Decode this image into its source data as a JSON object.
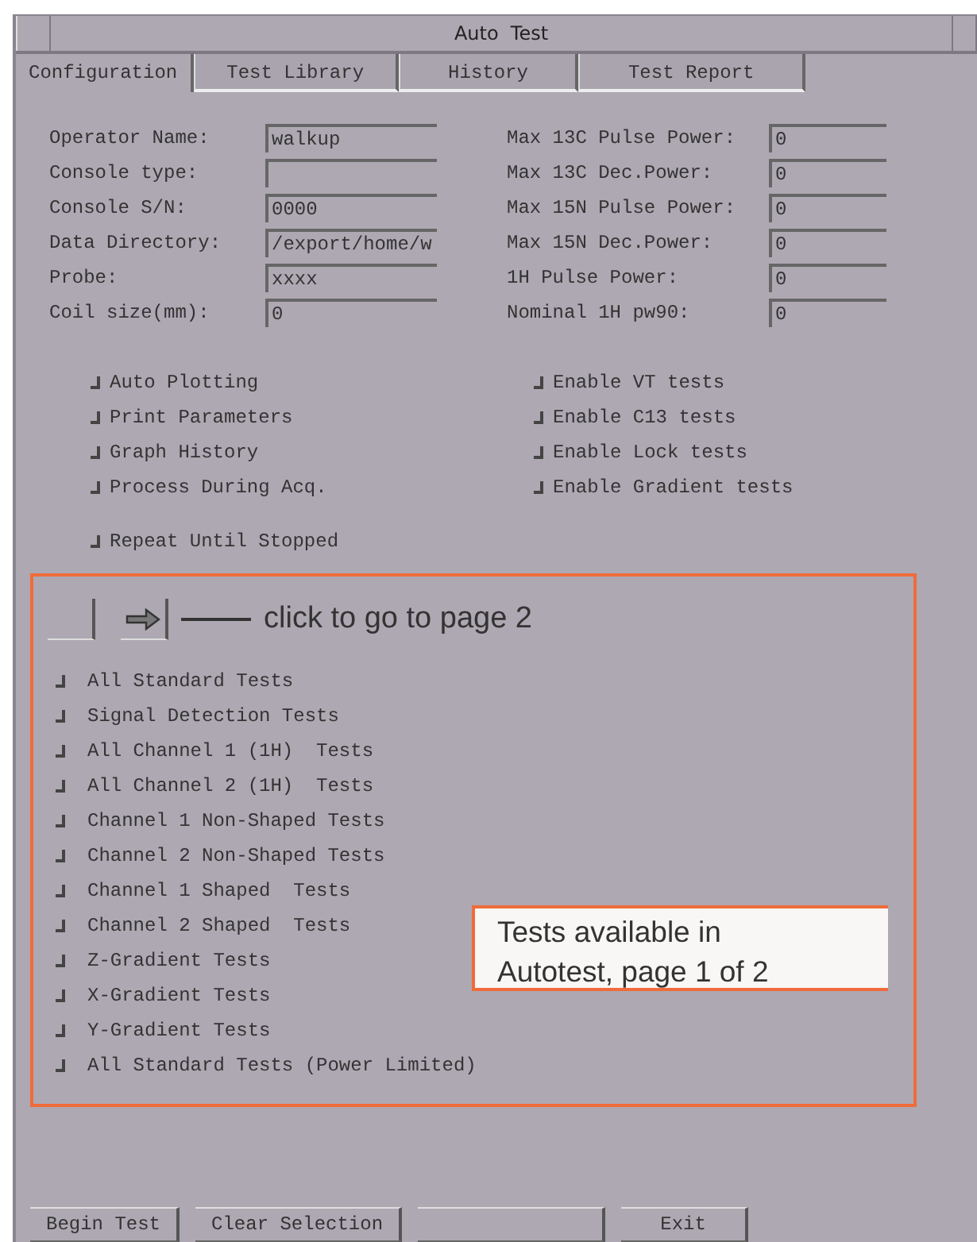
{
  "window": {
    "title": "Auto  Test"
  },
  "tabs": [
    {
      "label": "Configuration",
      "selected": true
    },
    {
      "label": "Test Library",
      "selected": false
    },
    {
      "label": "History",
      "selected": false
    },
    {
      "label": "Test Report",
      "selected": false
    }
  ],
  "fields_left": [
    {
      "label": "Operator Name:",
      "value": "walkup"
    },
    {
      "label": "Console type:"
    },
    {
      "label": "Console S/N:",
      "value": "0000"
    },
    {
      "label": "Data Directory:",
      "value": "/export/home/w"
    },
    {
      "label": "Probe:",
      "value": "xxxx"
    },
    {
      "label": "Coil size(mm):",
      "value": "0"
    }
  ],
  "fields_right": [
    {
      "label": "Max 13C Pulse Power:",
      "value": "0"
    },
    {
      "label": "Max 13C Dec.Power:",
      "value": "0"
    },
    {
      "label": "Max 15N Pulse Power:",
      "value": "0"
    },
    {
      "label": "Max 15N Dec.Power:",
      "value": "0"
    },
    {
      "label": "1H Pulse Power:",
      "value": "0"
    },
    {
      "label": "Nominal 1H pw90:",
      "value": "0"
    }
  ],
  "options_left": [
    {
      "label": "Auto Plotting",
      "checked": false
    },
    {
      "label": "Print Parameters",
      "checked": false
    },
    {
      "label": "Graph History",
      "checked": false
    },
    {
      "label": "Process During Acq.",
      "checked": false
    }
  ],
  "options_right": [
    {
      "label": "Enable VT tests",
      "checked": false
    },
    {
      "label": "Enable C13 tests",
      "checked": false
    },
    {
      "label": "Enable Lock tests",
      "checked": false
    },
    {
      "label": "Enable Gradient tests",
      "checked": false
    }
  ],
  "repeat_option": {
    "label": "Repeat Until Stopped",
    "checked": false
  },
  "page_note": "click to go to page 2",
  "tests": [
    {
      "label": "All Standard Tests",
      "checked": false
    },
    {
      "label": "Signal Detection Tests",
      "checked": false
    },
    {
      "label": "All Channel 1 (1H)  Tests",
      "checked": false
    },
    {
      "label": "All Channel 2 (1H)  Tests",
      "checked": false
    },
    {
      "label": "Channel 1 Non-Shaped Tests",
      "checked": false
    },
    {
      "label": "Channel 2 Non-Shaped Tests",
      "checked": false
    },
    {
      "label": "Channel 1 Shaped  Tests",
      "checked": false
    },
    {
      "label": "Channel 2 Shaped  Tests",
      "checked": false
    },
    {
      "label": "Z-Gradient Tests",
      "checked": false
    },
    {
      "label": "X-Gradient Tests",
      "checked": false
    },
    {
      "label": "Y-Gradient Tests",
      "checked": false
    },
    {
      "label": "All Standard Tests (Power Limited)",
      "checked": false
    }
  ],
  "callout": "Tests available in Autotest, page 1 of 2",
  "buttons": [
    {
      "kind": "labeled",
      "label": "Begin Test"
    },
    {
      "kind": "labeled",
      "label": "Clear Selection"
    },
    {
      "kind": "blank"
    },
    {
      "kind": "labeled",
      "label": "Exit"
    }
  ]
}
